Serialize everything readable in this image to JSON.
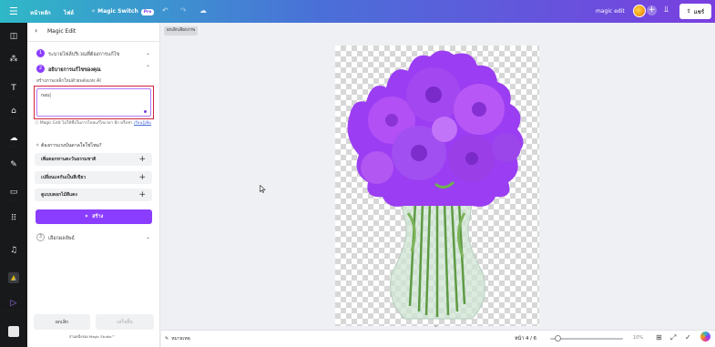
{
  "topbar": {
    "menu_icon": "menu-icon",
    "home": "หน้าหลัก",
    "resize": "ไฟล์",
    "switch_label": "✧ Magic Switch",
    "switch_badge": "Pro",
    "title": "magic edit",
    "share_label": "แชร์",
    "colors": {
      "start": "#2fb8c7",
      "mid": "#4a6fd8",
      "end": "#7a3fe0"
    }
  },
  "rail": {
    "items": [
      {
        "label": "ดีไซน์",
        "icon": "layout-icon"
      },
      {
        "label": "องค์ประกอบ",
        "icon": "shapes-icon"
      },
      {
        "label": "ข้อความ",
        "icon": "text-icon"
      },
      {
        "label": "Brand",
        "icon": "brand-icon"
      },
      {
        "label": "อัปโหลด",
        "icon": "upload-icon"
      },
      {
        "label": "วาด",
        "icon": "draw-icon"
      },
      {
        "label": "โปรเจกต์",
        "icon": "folder-icon"
      },
      {
        "label": "แอพ",
        "icon": "apps-icon"
      },
      {
        "label": "เสียง",
        "icon": "audio-icon"
      },
      {
        "label": "Google Drive",
        "icon": "google-drive-icon"
      },
      {
        "label": "HeyGen AI A...",
        "icon": "heygen-icon"
      },
      {
        "label": "",
        "icon": "app-icon"
      }
    ]
  },
  "panel": {
    "title": "Magic Edit",
    "step1": {
      "num": "1",
      "label": "ระบายไฟล์บริเวณที่ต้องการแก้ไข"
    },
    "step2": {
      "num": "2",
      "label": "อธิบายการแก้ไขของคุณ",
      "desc": "สร้างภาพเหล็กใหม่ด้วยพลังแห่ง AI"
    },
    "prompt_value": "กอบ|",
    "info_text": "Magic Edit ไม่ใช้ชื่อในการไหลแก้ไขเวลา อีก หรือชา ",
    "info_link": "เรียนรู้เพิ่ม",
    "idea_label": "ต้องการแรงบันดาลใจใช่ไหม?",
    "suggestions": [
      "เพิ่มดอกทานตะวันธรรมชาติ",
      "เปลี่ยนแจกันเป็นสีเขียว",
      "ดูแบบดอกไม้สีแดง"
    ],
    "generate_label": "สร้าง",
    "step3": {
      "num": "3",
      "label": "เลือกผลลัพธ์"
    },
    "cancel_label": "ยกเลิก",
    "done_label": "เสร็จสิ้น",
    "footnote": "ส่วนหนึ่งของ Magic Studio™"
  },
  "canvas": {
    "chip_label": "ยกเลิกเลือกภาพ"
  },
  "status": {
    "notes_label": "หมายเหตุ",
    "pages_label": "หน้า 4 / 6",
    "zoom_label": "10%",
    "zoom_fraction": 0.1
  }
}
